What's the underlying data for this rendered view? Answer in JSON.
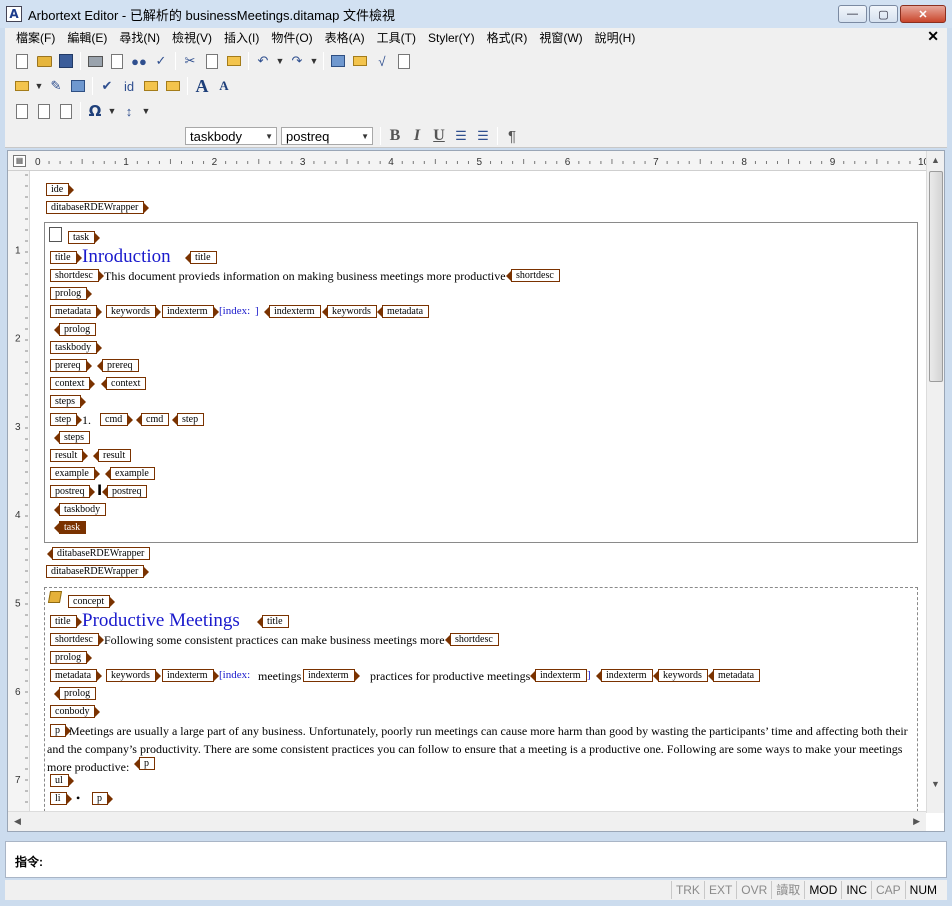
{
  "window": {
    "app_icon": "A",
    "title": "Arbortext Editor - 已解析的 businessMeetings.ditamap 文件檢視",
    "controls": {
      "minimize": "—",
      "maximize": "▢",
      "close": "✕"
    }
  },
  "menu": {
    "items": [
      "檔案(F)",
      "編輯(E)",
      "尋找(N)",
      "檢視(V)",
      "插入(I)",
      "物件(O)",
      "表格(A)",
      "工具(T)",
      "Styler(Y)",
      "格式(R)",
      "視窗(W)",
      "說明(H)"
    ],
    "close": "✕"
  },
  "toolbar": {
    "style_value": "taskbody",
    "element_value": "postreq",
    "bold": "B",
    "italic": "I",
    "underline": "U",
    "paragraph": "¶",
    "font_larger": "A",
    "font_smaller": "A",
    "omega": "Ω"
  },
  "ruler": {
    "corner": "▦",
    "h_labels": [
      "0",
      "1",
      "2",
      "3",
      "4",
      "5",
      "6",
      "7",
      "8",
      "9",
      "10"
    ],
    "v_labels": [
      "1",
      "2",
      "3",
      "4",
      "5",
      "6",
      "7"
    ]
  },
  "document": {
    "task_title": "Inroduction",
    "task_shortdesc": "This document provieds information on making business meetings more productive",
    "index_open": "[index:",
    "index_close": "]",
    "step_number": "1.",
    "concept_title": "Productive Meetings",
    "concept_shortdesc": "Following some consistent practices can make business meetings more",
    "concept_index_term1": "meetings",
    "concept_index_term2": "practices for productive meetings",
    "concept_para": "Meetings are usually a large part of any business. Unfortunately, poorly run meetings can cause more harm than good by wasting the participants’ time and affecting both their and the company’s productivity. There are some consistent practices you can follow to ensure that a meeting is a productive one. Following are some ways to make your meetings more productive:",
    "li_bullet": "•",
    "tags": {
      "ide": "ide",
      "wrapper": "ditabaseRDEWrapper",
      "task": "task",
      "title": "title",
      "shortdesc": "shortdesc",
      "prolog": "prolog",
      "metadata": "metadata",
      "keywords": "keywords",
      "indexterm": "indexterm",
      "taskbody": "taskbody",
      "prereq": "prereq",
      "context": "context",
      "steps": "steps",
      "step": "step",
      "cmd": "cmd",
      "result": "result",
      "example": "example",
      "postreq": "postreq",
      "concept": "concept",
      "conbody": "conbody",
      "p": "p",
      "ul": "ul",
      "li": "li"
    }
  },
  "command": {
    "label": "指令:"
  },
  "status": {
    "items": [
      {
        "label": "TRK",
        "active": false
      },
      {
        "label": "EXT",
        "active": false
      },
      {
        "label": "OVR",
        "active": false
      },
      {
        "label": "讀取",
        "active": false
      },
      {
        "label": "MOD",
        "active": true
      },
      {
        "label": "INC",
        "active": true
      },
      {
        "label": "CAP",
        "active": false
      },
      {
        "label": "NUM",
        "active": true
      }
    ]
  }
}
